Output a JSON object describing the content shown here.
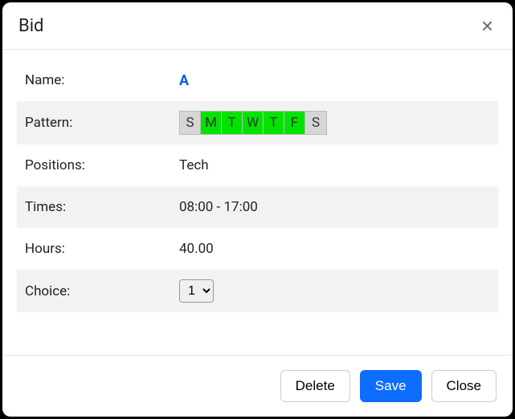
{
  "modal": {
    "title": "Bid"
  },
  "fields": {
    "name_label": "Name:",
    "name_value": "A",
    "pattern_label": "Pattern:",
    "positions_label": "Positions:",
    "positions_value": "Tech",
    "times_label": "Times:",
    "times_value": "08:00 - 17:00",
    "hours_label": "Hours:",
    "hours_value": "40.00",
    "choice_label": "Choice:",
    "choice_value": "1"
  },
  "pattern": {
    "days": [
      {
        "letter": "S",
        "on": false
      },
      {
        "letter": "M",
        "on": true
      },
      {
        "letter": "T",
        "on": true
      },
      {
        "letter": "W",
        "on": true
      },
      {
        "letter": "T",
        "on": true
      },
      {
        "letter": "F",
        "on": true
      },
      {
        "letter": "S",
        "on": false
      }
    ]
  },
  "actions": {
    "delete": "Delete",
    "save": "Save",
    "close": "Close"
  }
}
